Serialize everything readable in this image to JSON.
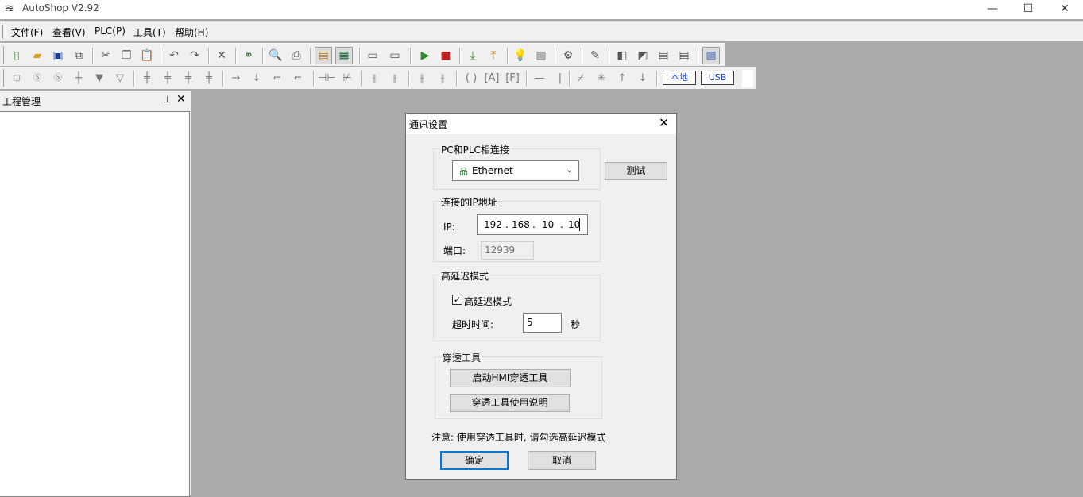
{
  "window": {
    "title": "AutoShop V2.92",
    "app_icon": "autoshop-logo-icon",
    "controls": [
      "minimize-icon",
      "maximize-icon",
      "close-icon"
    ]
  },
  "menu": [
    "文件(F)",
    "查看(V)",
    "PLC(P)",
    "工具(T)",
    "帮助(H)"
  ],
  "toolbar2": {
    "local_label": "本地",
    "usb_label": "USB"
  },
  "project_panel": {
    "title": "工程管理"
  },
  "dialog": {
    "title": "通讯设置",
    "group_connection": "PC和PLC相连接",
    "connection_type": "Ethernet",
    "test_button": "测试",
    "group_ip": "连接的IP地址",
    "ip_label": "IP:",
    "ip": [
      "192",
      "168",
      "10",
      "10"
    ],
    "port_label": "端口:",
    "port_value": "12939",
    "group_latency": "高延迟模式",
    "latency_checkbox_label": "高延迟模式",
    "latency_checked": true,
    "timeout_label": "超时时间:",
    "timeout_value": "5",
    "timeout_unit": "秒",
    "group_tunnel": "穿透工具",
    "start_hmi_button": "启动HMI穿透工具",
    "tunnel_help_button": "穿透工具使用说明",
    "note": "注意: 使用穿透工具时, 请勾选高延迟模式",
    "ok_button": "确定",
    "cancel_button": "取消"
  }
}
